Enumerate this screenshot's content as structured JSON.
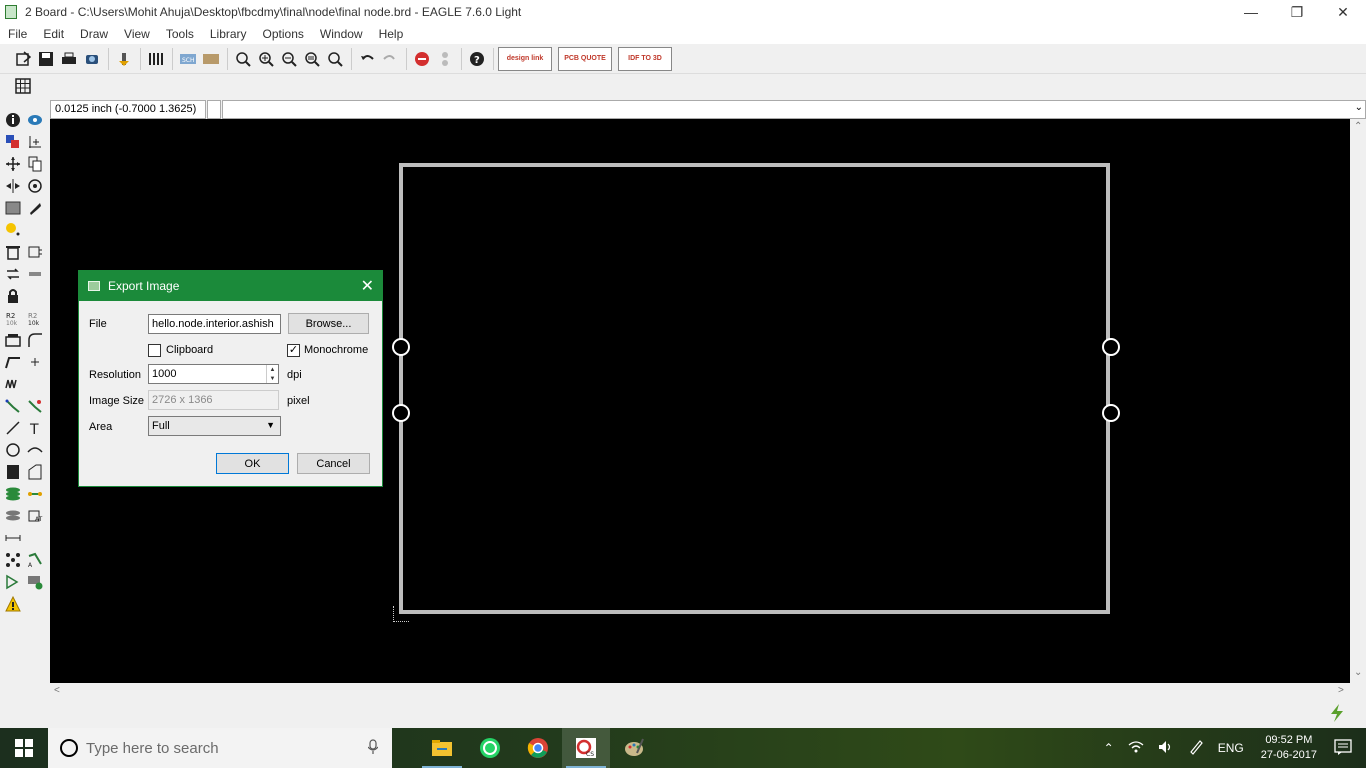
{
  "window": {
    "title": "2 Board - C:\\Users\\Mohit Ahuja\\Desktop\\fbcdmy\\final\\node\\final node.brd - EAGLE 7.6.0 Light"
  },
  "menu": [
    "File",
    "Edit",
    "Draw",
    "View",
    "Tools",
    "Library",
    "Options",
    "Window",
    "Help"
  ],
  "toolbar": {
    "design_link": "design link",
    "pcb_quote": "PCB QUOTE",
    "idf": "IDF TO 3D"
  },
  "coordinates": {
    "readout": "0.0125 inch (-0.7000 1.3625)"
  },
  "dialog": {
    "title": "Export Image",
    "file_label": "File",
    "file_value": "hello.node.interior.ashish",
    "browse_label": "Browse...",
    "clipboard_label": "Clipboard",
    "clipboard_checked": false,
    "monochrome_label": "Monochrome",
    "monochrome_checked": true,
    "resolution_label": "Resolution",
    "resolution_value": "1000",
    "resolution_unit": "dpi",
    "image_size_label": "Image Size",
    "image_size_value": "2726 x 1366",
    "image_size_unit": "pixel",
    "area_label": "Area",
    "area_value": "Full",
    "ok_label": "OK",
    "cancel_label": "Cancel"
  },
  "taskbar": {
    "search_placeholder": "Type here to search",
    "language": "ENG",
    "time": "09:52 PM",
    "date": "27-06-2017"
  },
  "colors": {
    "dialog_titlebar": "#1b8a3a",
    "canvas": "#000000",
    "board_outline": "#bdbdbd"
  }
}
